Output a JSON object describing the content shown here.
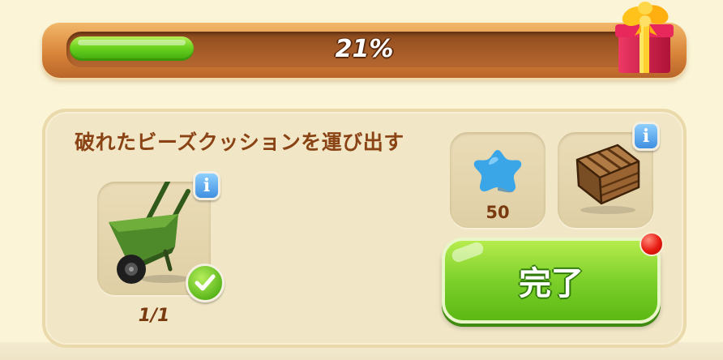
{
  "progress": {
    "percent_text": "21%",
    "fraction": 0.21
  },
  "task": {
    "title": "破れたビーズクッションを運び出す",
    "required_item": {
      "icon": "wheelbarrow-icon",
      "count": "1/1",
      "completed": true
    },
    "rewards": [
      {
        "icon": "star-icon",
        "amount": "50",
        "color": "#3aa6e8"
      },
      {
        "icon": "crate-icon",
        "amount": ""
      }
    ],
    "complete_button_label": "完了"
  },
  "colors": {
    "title_text": "#8a4314",
    "button_green": "#7dd02a",
    "progress_green": "#6bd21f",
    "notification_red": "#e81a10",
    "info_blue": "#3f8fe0"
  }
}
